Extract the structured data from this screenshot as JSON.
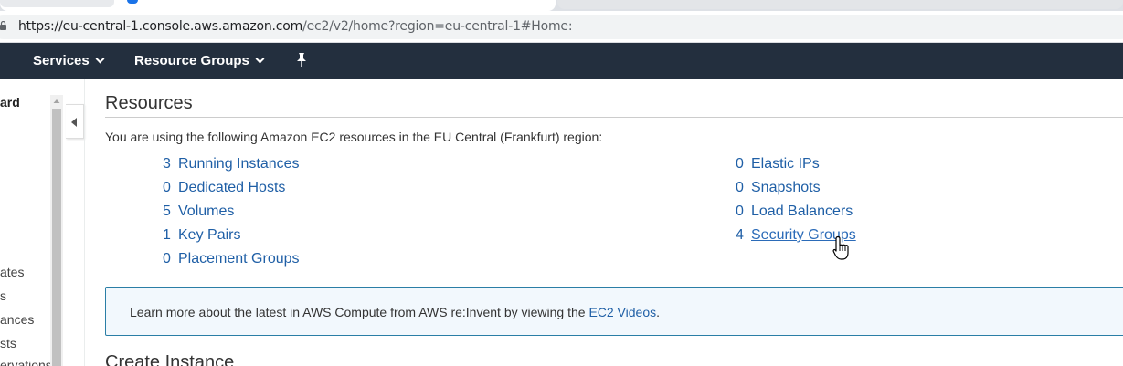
{
  "browser": {
    "url_host": "https://eu-central-1.console.aws.amazon.com",
    "url_path": "/ec2/v2/home?region=eu-central-1#Home:"
  },
  "nav": {
    "services_label": "Services",
    "resource_groups_label": "Resource Groups"
  },
  "sidebar": {
    "items": [
      "ard",
      "ates",
      "s",
      "ances",
      "sts",
      "ervations"
    ]
  },
  "resources": {
    "title": "Resources",
    "description": "You are using the following Amazon EC2 resources in the EU Central (Frankfurt) region:",
    "left": [
      {
        "count": "3",
        "label": "Running Instances"
      },
      {
        "count": "0",
        "label": "Dedicated Hosts"
      },
      {
        "count": "5",
        "label": "Volumes"
      },
      {
        "count": "1",
        "label": "Key Pairs"
      },
      {
        "count": "0",
        "label": "Placement Groups"
      }
    ],
    "right": [
      {
        "count": "0",
        "label": "Elastic IPs"
      },
      {
        "count": "0",
        "label": "Snapshots"
      },
      {
        "count": "0",
        "label": "Load Balancers"
      },
      {
        "count": "4",
        "label": "Security Groups"
      }
    ]
  },
  "info": {
    "text": "Learn more about the latest in AWS Compute from AWS re:Invent by viewing the ",
    "link": "EC2 Videos",
    "suffix": "."
  },
  "create_instance": {
    "title": "Create Instance"
  },
  "colors": {
    "nav_bg": "#232f3e",
    "link": "#1f5fa6",
    "info_border": "#2a7ea6",
    "info_bg": "#f2f8fd"
  }
}
